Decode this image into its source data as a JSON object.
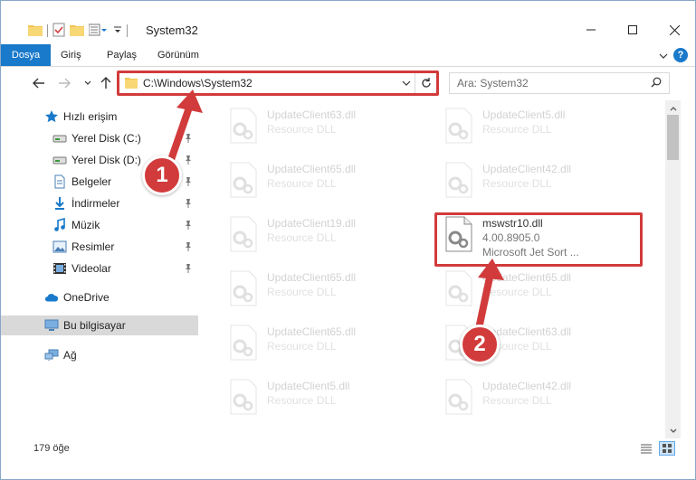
{
  "window": {
    "title": "System32",
    "controls": {
      "minimize": "minimize-icon",
      "maximize": "maximize-icon",
      "close": "close-icon"
    }
  },
  "ribbon": {
    "tabs": [
      {
        "label": "Dosya"
      },
      {
        "label": "Giriş"
      },
      {
        "label": "Paylaş"
      },
      {
        "label": "Görünüm"
      }
    ],
    "help": "?"
  },
  "nav": {
    "address": "C:\\Windows\\System32",
    "search_placeholder": "Ara: System32"
  },
  "sidebar": {
    "items": [
      {
        "label": "Hızlı erişim",
        "icon": "star-icon",
        "pinned": false
      },
      {
        "label": "Yerel Disk (C:)",
        "icon": "drive-icon",
        "pinned": true
      },
      {
        "label": "Yerel Disk (D:)",
        "icon": "drive-icon",
        "pinned": true
      },
      {
        "label": "Belgeler",
        "icon": "documents-icon",
        "pinned": true
      },
      {
        "label": "İndirmeler",
        "icon": "download-icon",
        "pinned": true
      },
      {
        "label": "Müzik",
        "icon": "music-icon",
        "pinned": true
      },
      {
        "label": "Resimler",
        "icon": "pictures-icon",
        "pinned": true
      },
      {
        "label": "Videolar",
        "icon": "videos-icon",
        "pinned": true
      },
      {
        "label": "OneDrive",
        "icon": "cloud-icon",
        "pinned": false
      },
      {
        "label": "Bu bilgisayar",
        "icon": "computer-icon",
        "pinned": false,
        "selected": true
      },
      {
        "label": "Ağ",
        "icon": "network-icon",
        "pinned": false
      }
    ]
  },
  "files": {
    "left": [
      {
        "name": "UpdateClient63.dll",
        "type": "Resource DLL"
      },
      {
        "name": "UpdateClient65.dll",
        "type": "Resource DLL"
      },
      {
        "name": "UpdateClient19.dll",
        "type": "Resource DLL"
      },
      {
        "name": "UpdateClient65.dll",
        "type": "Resource DLL"
      },
      {
        "name": "UpdateClient65.dll",
        "type": "Resource DLL"
      },
      {
        "name": "UpdateClient5.dll",
        "type": "Resource DLL"
      }
    ],
    "right": [
      {
        "name": "UpdateClient5.dll",
        "type": "Resource DLL"
      },
      {
        "name": "UpdateClient42.dll",
        "type": "Resource DLL"
      },
      {
        "name": "UpdateClient65.dll",
        "type": "Resource DLL"
      },
      {
        "name": "UpdateClient63.dll",
        "type": "Resource DLL"
      },
      {
        "name": "UpdateClient42.dll",
        "type": "Resource DLL"
      }
    ],
    "highlighted": {
      "name": "mswstr10.dll",
      "version": "4.00.8905.0",
      "description": "Microsoft Jet Sort ..."
    }
  },
  "status": {
    "count": "179 öğe"
  },
  "annotations": {
    "badge1": "1",
    "badge2": "2",
    "color": "#d23b3b"
  }
}
